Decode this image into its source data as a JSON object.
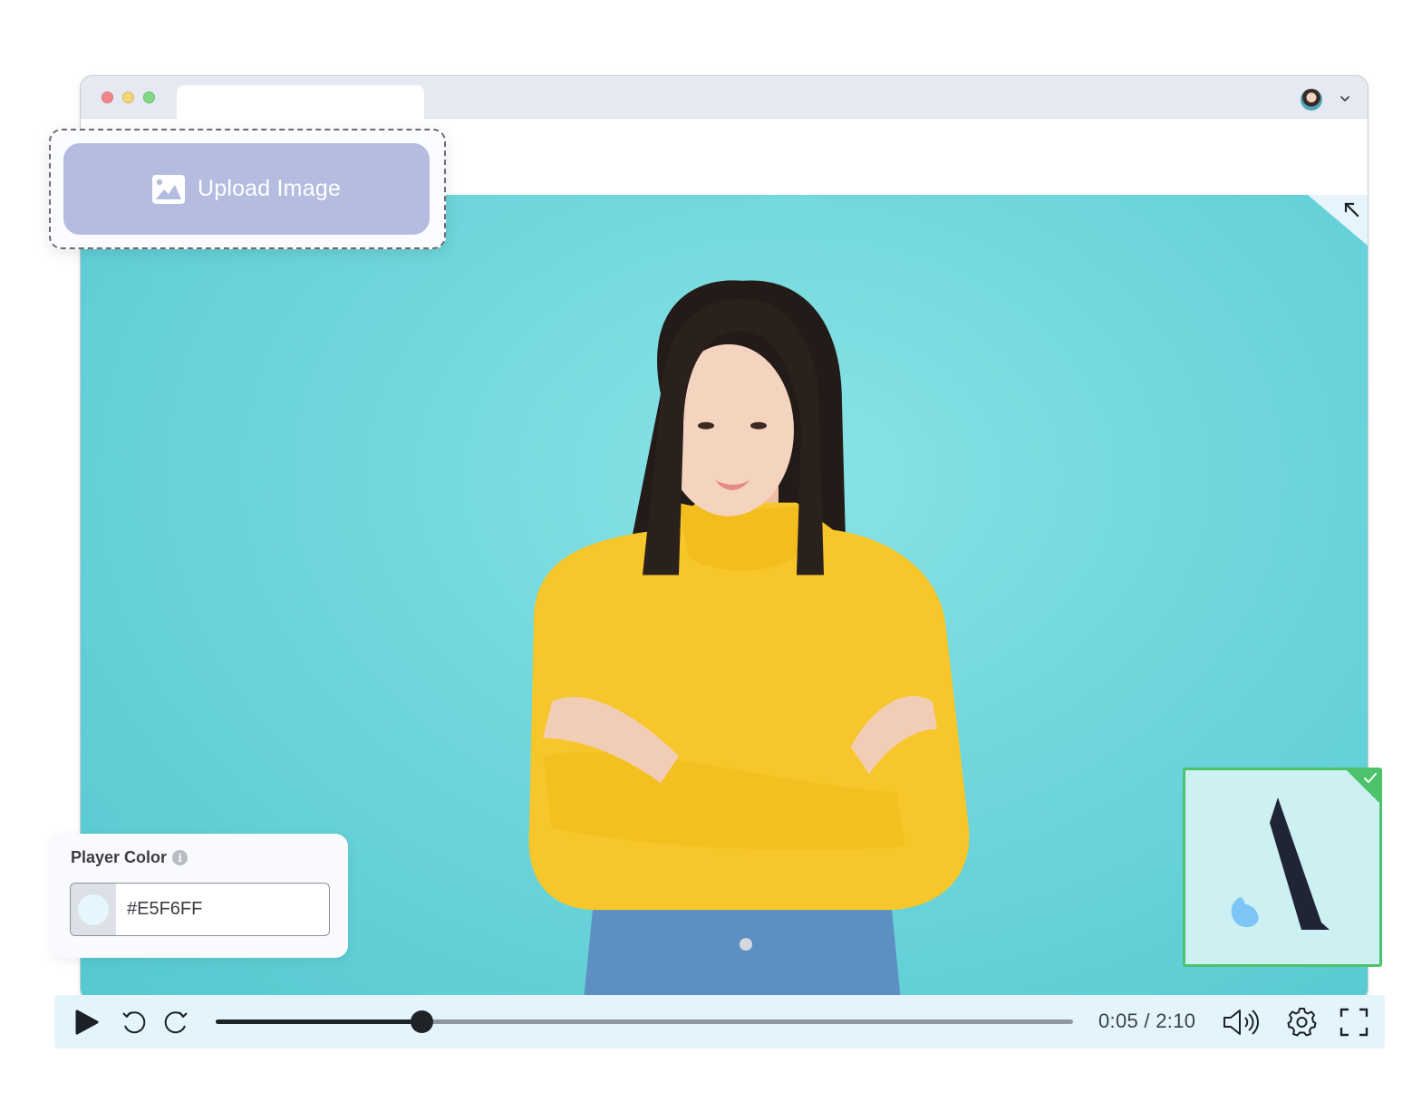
{
  "browser": {
    "tab_title": "",
    "account_avatar": "user-avatar",
    "account_menu_icon": "chevron-down-icon"
  },
  "upload": {
    "button_label": "Upload Image",
    "icon": "image-icon"
  },
  "player_color": {
    "title": "Player Color",
    "info_icon": "info-icon",
    "value": "#E5F6FF",
    "swatch_color": "#E5F6FF"
  },
  "logo_thumbnail": {
    "selected": true,
    "status_icon": "check-icon",
    "border_color": "#4CC26B"
  },
  "video": {
    "collapse_icon": "arrow-up-left-icon",
    "background_color": "#6FD6DC"
  },
  "controls": {
    "play_icon": "play-icon",
    "rewind_icon": "rewind-icon",
    "forward_icon": "forward-icon",
    "progress_fraction": 0.24,
    "current_time": "0:05",
    "separator": "/",
    "duration": "2:10",
    "time_display": "0:05 / 2:10",
    "volume_icon": "volume-icon",
    "settings_icon": "gear-icon",
    "fullscreen_icon": "fullscreen-icon",
    "bar_color": "#E4F4FD"
  }
}
